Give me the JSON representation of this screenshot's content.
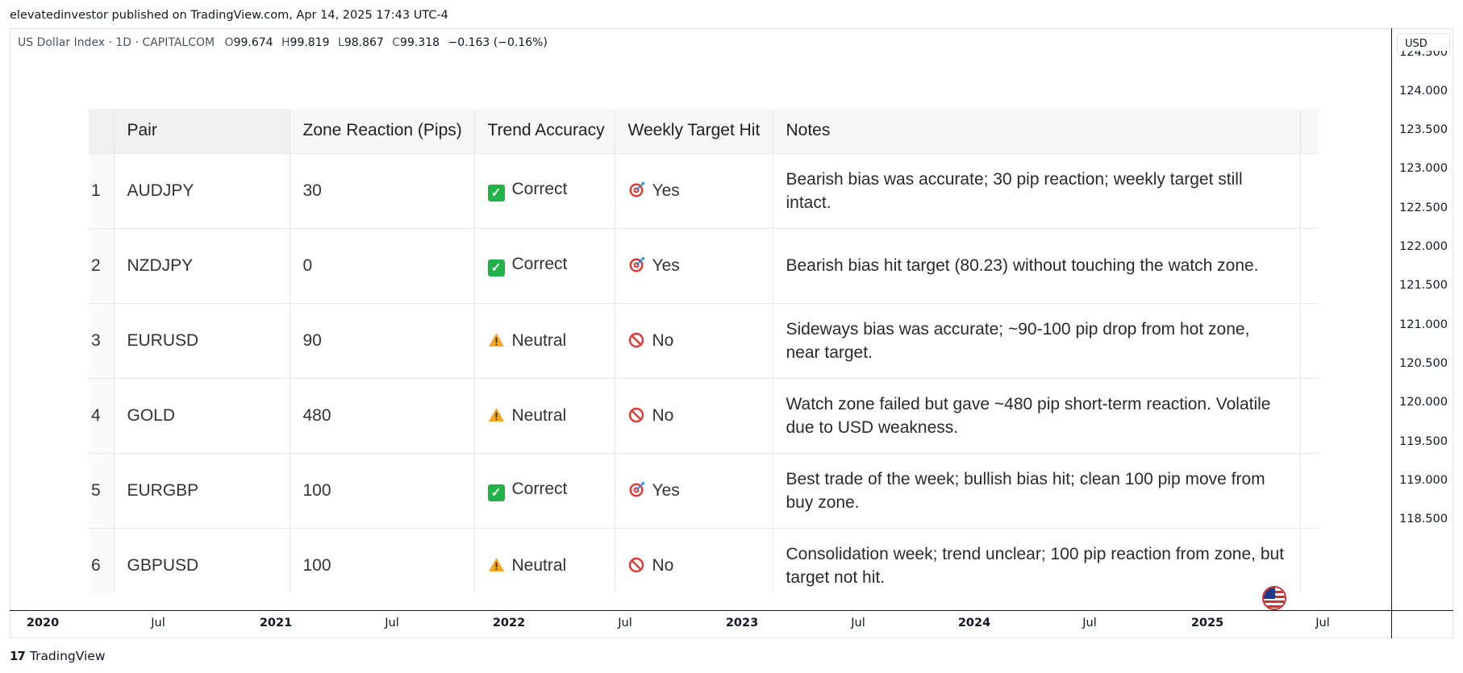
{
  "attribution": "elevatedinvestor published on TradingView.com, Apr 14, 2025 17:43 UTC-4",
  "legend": {
    "symbol": "US Dollar Index · 1D · CAPITALCOM",
    "open_label": "O",
    "open": "99.674",
    "high_label": "H",
    "high": "99.819",
    "low_label": "L",
    "low": "98.867",
    "close_label": "C",
    "close": "99.318",
    "change": "−0.163 (−0.16%)"
  },
  "currency": "USD",
  "price_axis": {
    "clipped_top": "124.500",
    "labels": [
      "124.000",
      "123.500",
      "123.000",
      "122.500",
      "122.000",
      "121.500",
      "121.000",
      "120.500",
      "120.000",
      "119.500",
      "119.000",
      "118.500"
    ]
  },
  "time_axis": {
    "labels": [
      {
        "text": "2020",
        "year": true
      },
      {
        "text": "Jul",
        "year": false
      },
      {
        "text": "2021",
        "year": true
      },
      {
        "text": "Jul",
        "year": false
      },
      {
        "text": "2022",
        "year": true
      },
      {
        "text": "Jul",
        "year": false
      },
      {
        "text": "2023",
        "year": true
      },
      {
        "text": "Jul",
        "year": false
      },
      {
        "text": "2024",
        "year": true
      },
      {
        "text": "Jul",
        "year": false
      },
      {
        "text": "2025",
        "year": true
      },
      {
        "text": "Jul",
        "year": false
      }
    ]
  },
  "brand": "TradingView",
  "brand_mark": "17",
  "table": {
    "headers": {
      "pair": "Pair",
      "zone": "Zone Reaction (Pips)",
      "trend": "Trend Accuracy",
      "weekly": "Weekly Target Hit",
      "notes": "Notes"
    },
    "rows": [
      {
        "n": "1",
        "pair": "AUDJPY",
        "zone": "30",
        "trend": "Correct",
        "trend_icon": "check-icon",
        "weekly": "Yes",
        "weekly_icon": "target-icon",
        "notes": "Bearish bias was accurate; 30 pip reaction; weekly target still intact."
      },
      {
        "n": "2",
        "pair": "NZDJPY",
        "zone": "0",
        "trend": "Correct",
        "trend_icon": "check-icon",
        "weekly": "Yes",
        "weekly_icon": "target-icon",
        "notes": "Bearish bias hit target (80.23) without touching the watch zone."
      },
      {
        "n": "3",
        "pair": "EURUSD",
        "zone": "90",
        "trend": "Neutral",
        "trend_icon": "warning-icon",
        "weekly": "No",
        "weekly_icon": "prohibited-icon",
        "notes": "Sideways bias was accurate; ~90-100 pip drop from hot zone, near target."
      },
      {
        "n": "4",
        "pair": "GOLD",
        "zone": "480",
        "trend": "Neutral",
        "trend_icon": "warning-icon",
        "weekly": "No",
        "weekly_icon": "prohibited-icon",
        "notes": "Watch zone failed but gave ~480 pip short-term reaction. Volatile due to USD weakness."
      },
      {
        "n": "5",
        "pair": "EURGBP",
        "zone": "100",
        "trend": "Correct",
        "trend_icon": "check-icon",
        "weekly": "Yes",
        "weekly_icon": "target-icon",
        "notes": "Best trade of the week; bullish bias hit; clean 100 pip move from buy zone."
      },
      {
        "n": "6",
        "pair": "GBPUSD",
        "zone": "100",
        "trend": "Neutral",
        "trend_icon": "warning-icon",
        "weekly": "No",
        "weekly_icon": "prohibited-icon",
        "notes": "Consolidation week; trend unclear; 100 pip reaction from zone, but target not hit."
      }
    ]
  },
  "colors": {
    "check": "#21b34a",
    "warning": "#f5a623",
    "prohibited": "#e53935",
    "target": "#e53935"
  }
}
